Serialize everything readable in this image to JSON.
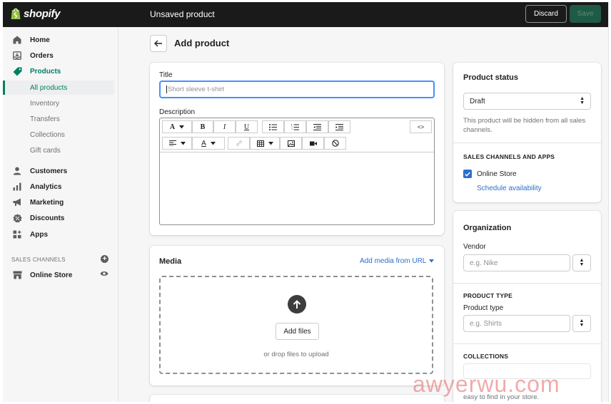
{
  "topbar": {
    "brand": "shopify",
    "page_state": "Unsaved product",
    "discard_label": "Discard",
    "save_label": "Save"
  },
  "sidebar": {
    "items": [
      {
        "label": "Home",
        "icon": "home-icon"
      },
      {
        "label": "Orders",
        "icon": "orders-icon"
      },
      {
        "label": "Products",
        "icon": "tag-icon"
      }
    ],
    "product_sub_items": [
      "All products",
      "Inventory",
      "Transfers",
      "Collections",
      "Gift cards"
    ],
    "more_items": [
      {
        "label": "Customers",
        "icon": "customers-icon"
      },
      {
        "label": "Analytics",
        "icon": "analytics-icon"
      },
      {
        "label": "Marketing",
        "icon": "megaphone-icon"
      },
      {
        "label": "Discounts",
        "icon": "discount-icon"
      },
      {
        "label": "Apps",
        "icon": "apps-icon"
      }
    ],
    "sales_channels_heading": "SALES CHANNELS",
    "online_store_label": "Online Store",
    "accent_color": "#008060"
  },
  "page": {
    "title": "Add product"
  },
  "product_form": {
    "title_label": "Title",
    "title_placeholder": "Short sleeve t-shirt",
    "description_label": "Description",
    "html_toggle": "<>"
  },
  "media": {
    "heading": "Media",
    "add_from_url": "Add media from URL",
    "add_files_label": "Add files",
    "drop_hint": "or drop files to upload"
  },
  "status_card": {
    "heading": "Product status",
    "selected_status": "Draft",
    "hint": "This product will be hidden from all sales channels.",
    "channels_heading": "SALES CHANNELS AND APPS",
    "channel_name": "Online Store",
    "channel_checked": true,
    "schedule_link": "Schedule availability"
  },
  "organization": {
    "heading": "Organization",
    "vendor_label": "Vendor",
    "vendor_placeholder": "e.g. Nike",
    "product_type_heading": "PRODUCT TYPE",
    "product_type_label": "Product type",
    "product_type_placeholder": "e.g. Shirts",
    "collections_heading": "COLLECTIONS",
    "collections_hint_tail": "easy to find in your store."
  },
  "watermark": "awyerwu.com"
}
